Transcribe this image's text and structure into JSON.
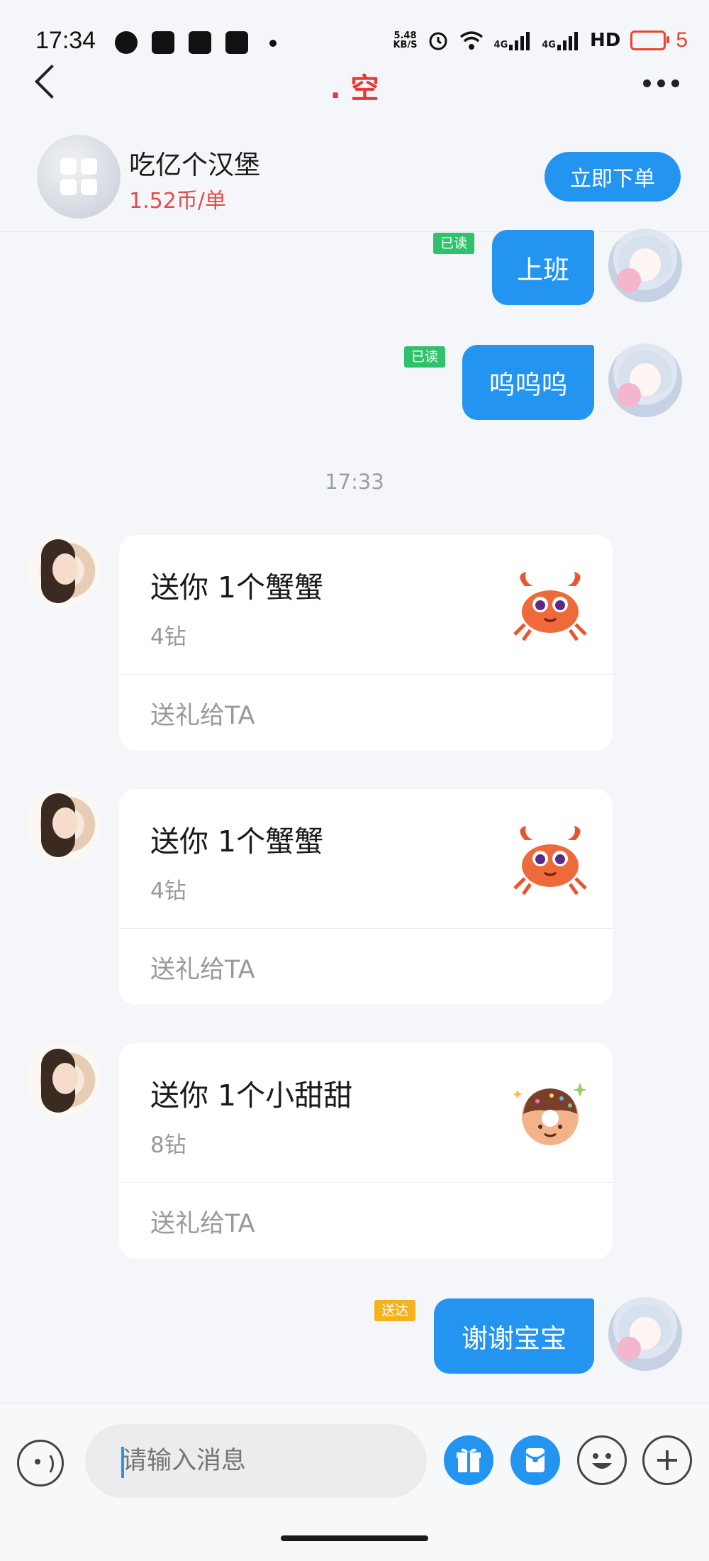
{
  "status_bar": {
    "time": "17:34",
    "net_speed_value": "5.48",
    "net_speed_unit": "KB/S",
    "signal_1": "4G",
    "signal_2": "4G",
    "hd_label": "HD",
    "battery_level": "5",
    "accent_color": "#e8452a"
  },
  "nav": {
    "title": ". 空",
    "title_color": "#e53935"
  },
  "order_header": {
    "service_name": "吃亿个汉堡",
    "price": "1.52币/单",
    "order_button_label": "立即下单",
    "accent_color": "#2394f0"
  },
  "messages": {
    "m1": {
      "text": "上班",
      "status": "已读"
    },
    "m2": {
      "text": "呜呜呜",
      "status": "已读"
    },
    "timestamp": "17:33",
    "g1": {
      "title": "送你 1个蟹蟹",
      "price": "4钻",
      "action": "送礼给TA",
      "icon": "crab-icon"
    },
    "g2": {
      "title": "送你 1个蟹蟹",
      "price": "4钻",
      "action": "送礼给TA",
      "icon": "crab-icon"
    },
    "g3": {
      "title": "送你 1个小甜甜",
      "price": "8钻",
      "action": "送礼给TA",
      "icon": "donut-icon"
    },
    "m3": {
      "text": "谢谢宝宝",
      "status": "送达"
    }
  },
  "input_bar": {
    "placeholder": "请输入消息",
    "icons": [
      "voice-icon",
      "gift-icon",
      "red-packet-icon",
      "emoji-icon",
      "plus-icon"
    ]
  }
}
